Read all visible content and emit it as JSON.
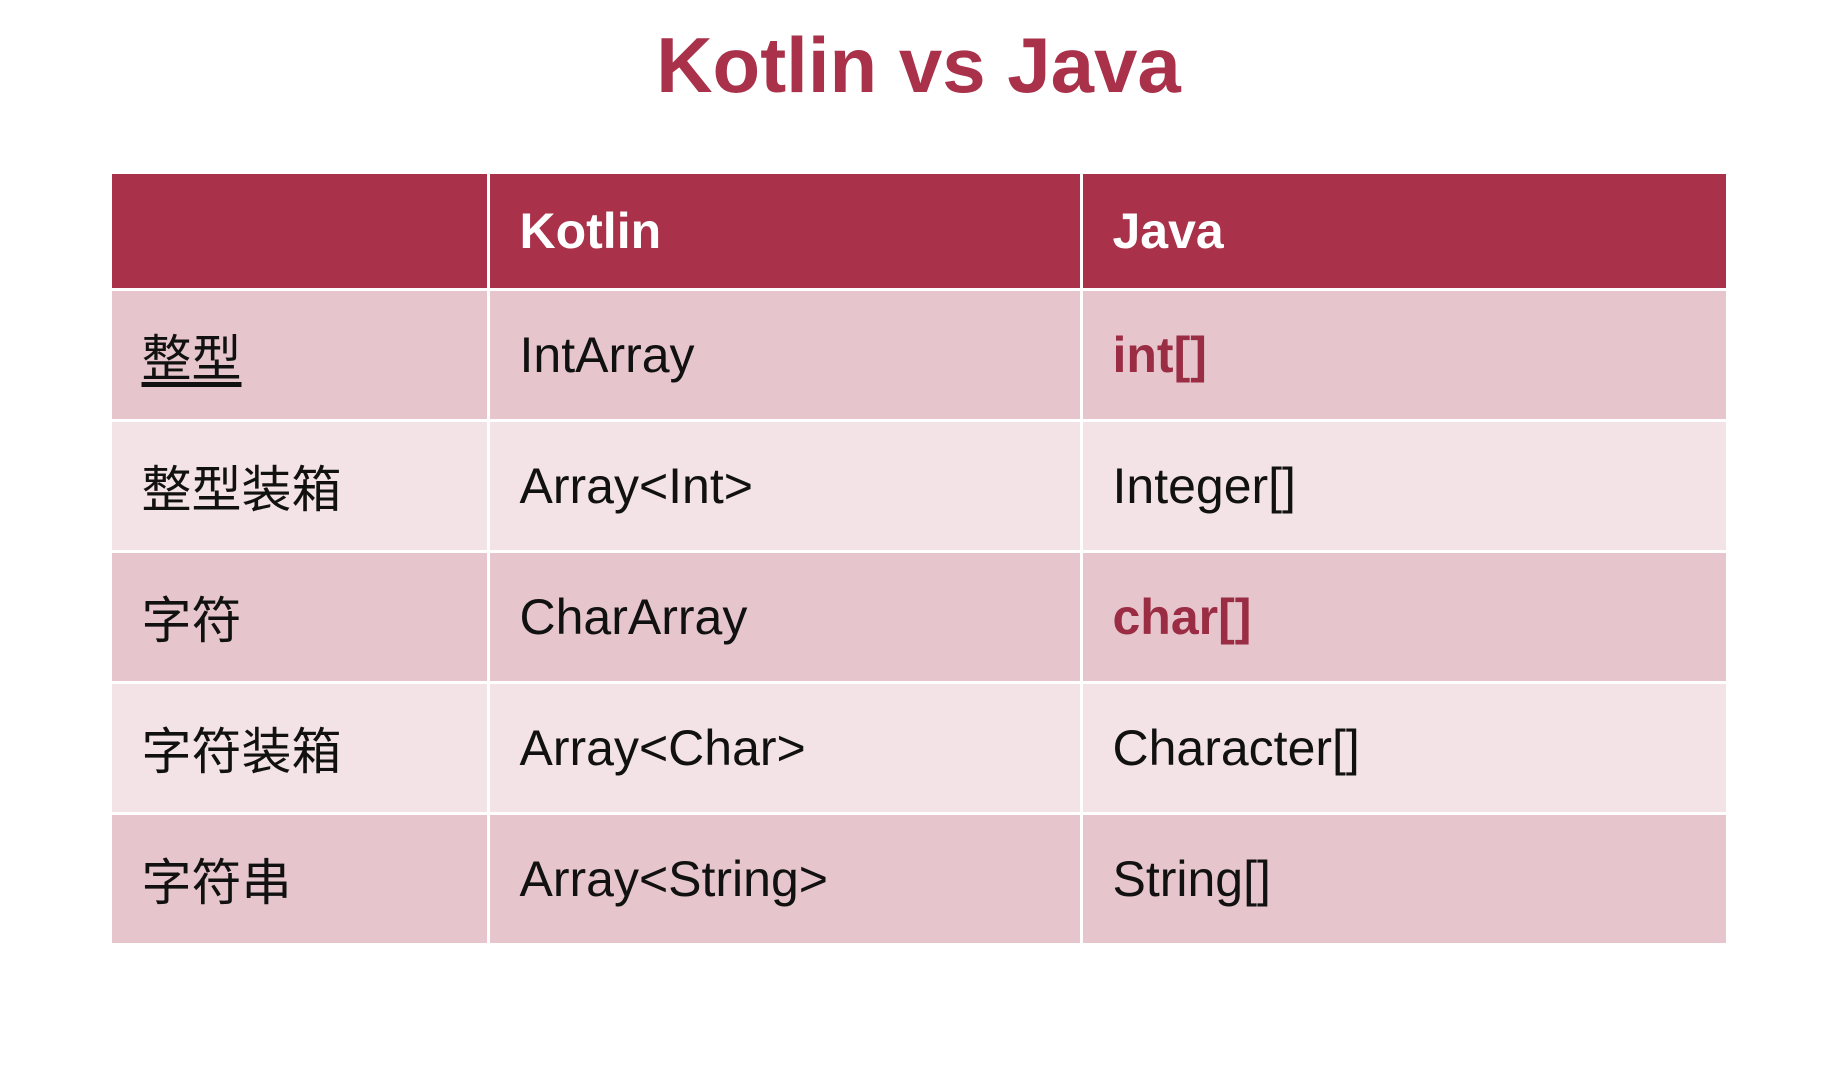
{
  "title": "Kotlin vs Java",
  "headers": {
    "col1": "",
    "col2": "Kotlin",
    "col3": "Java"
  },
  "rows": [
    {
      "label": "整型",
      "kotlin": "IntArray",
      "java": "int[]",
      "javaHighlight": true
    },
    {
      "label": "整型装箱",
      "kotlin": "Array<Int>",
      "java": "Integer[]",
      "javaHighlight": false
    },
    {
      "label": "字符",
      "kotlin": "CharArray",
      "java": "char[]",
      "javaHighlight": true
    },
    {
      "label": "字符装箱",
      "kotlin": "Array<Char>",
      "java": "Character[]",
      "javaHighlight": false
    },
    {
      "label": "字符串",
      "kotlin": "Array<String>",
      "java": "String[]",
      "javaHighlight": false
    }
  ]
}
